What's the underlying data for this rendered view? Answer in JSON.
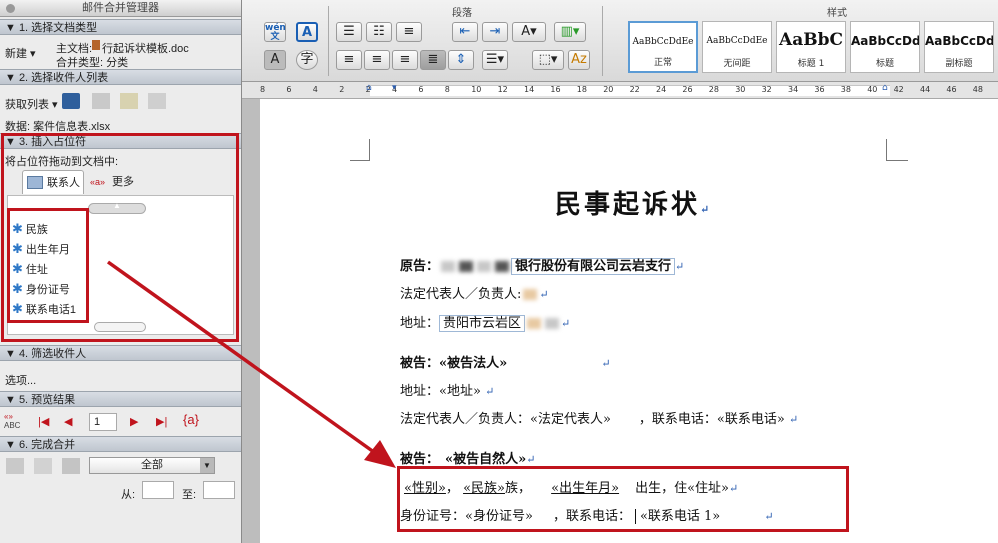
{
  "panel": {
    "title": "邮件合并管理器",
    "s1": {
      "header": "▼ 1. 选择文档类型",
      "new_label": "新建",
      "main_doc_label": "主文档:",
      "main_doc_value": "行起诉状模板.doc",
      "merge_type": "合并类型: 分类"
    },
    "s2": {
      "header": "▼ 2. 选择收件人列表",
      "get_list": "获取列表",
      "data_label": "数据: 案件信息表.xlsx"
    },
    "s3": {
      "header": "▼ 3. 插入占位符",
      "hint": "将占位符拖动到文档中:",
      "tab_contacts": "联系人",
      "tab_more": "更多",
      "fields": [
        "民族",
        "出生年月",
        "住址",
        "身份证号",
        "联系电话1"
      ]
    },
    "s4": {
      "header": "▼ 4. 筛选收件人",
      "options": "选项..."
    },
    "s5": {
      "header": "▼ 5. 预览结果",
      "abc": "ABC",
      "page_value": "1",
      "field_code": "{a}"
    },
    "s6": {
      "header": "▼ 6. 完成合并",
      "select_value": "全部",
      "from_label": "从:",
      "to_label": "至:"
    }
  },
  "ribbon": {
    "paragraph_group": "段落",
    "styles_group": "样式",
    "styles": [
      {
        "sample": "AaBbCcDdEe",
        "name": "正常"
      },
      {
        "sample": "AaBbCcDdEe",
        "name": "无间距"
      },
      {
        "sample": "AaBbC",
        "name": "标题 1"
      },
      {
        "sample": "AaBbCcDd",
        "name": "标题"
      },
      {
        "sample": "AaBbCcDd",
        "name": "副标题"
      }
    ]
  },
  "ruler": {
    "numbers": [
      "8",
      "6",
      "4",
      "2",
      "2",
      "4",
      "6",
      "8",
      "10",
      "12",
      "14",
      "16",
      "18",
      "20",
      "22",
      "24",
      "26",
      "28",
      "30",
      "32",
      "34",
      "36",
      "38",
      "40",
      "42",
      "44",
      "46",
      "48"
    ]
  },
  "doc": {
    "title": "民事起诉状",
    "plaintiff_label": "原告：",
    "plaintiff_value": "银行股份有限公司云岩支行",
    "rep_label": "法定代表人／负责人:",
    "addr_label": "地址：",
    "addr_value": "贵阳市云岩区",
    "def1_label": "被告：",
    "def1_value": "«被告法人»",
    "def1_addr": "地址：«地址»",
    "def1_rep": "法定代表人／负责人：«法定代表人»",
    "def1_phone": "，联系电话：«联系电话»",
    "def2_label": "被告：",
    "def2_value": "«被告自然人»",
    "gender": "«性别»",
    "ethnic": "«民族»",
    "ethnic_suffix": "族，",
    "birth": "«出生年月»",
    "born_text": "出生，住",
    "address": "«住址»",
    "id_label": "身份证号：",
    "id_value": "«身份证号»",
    "phone_label": "，联系电话：",
    "phone_value": "«联系电话 1»"
  }
}
